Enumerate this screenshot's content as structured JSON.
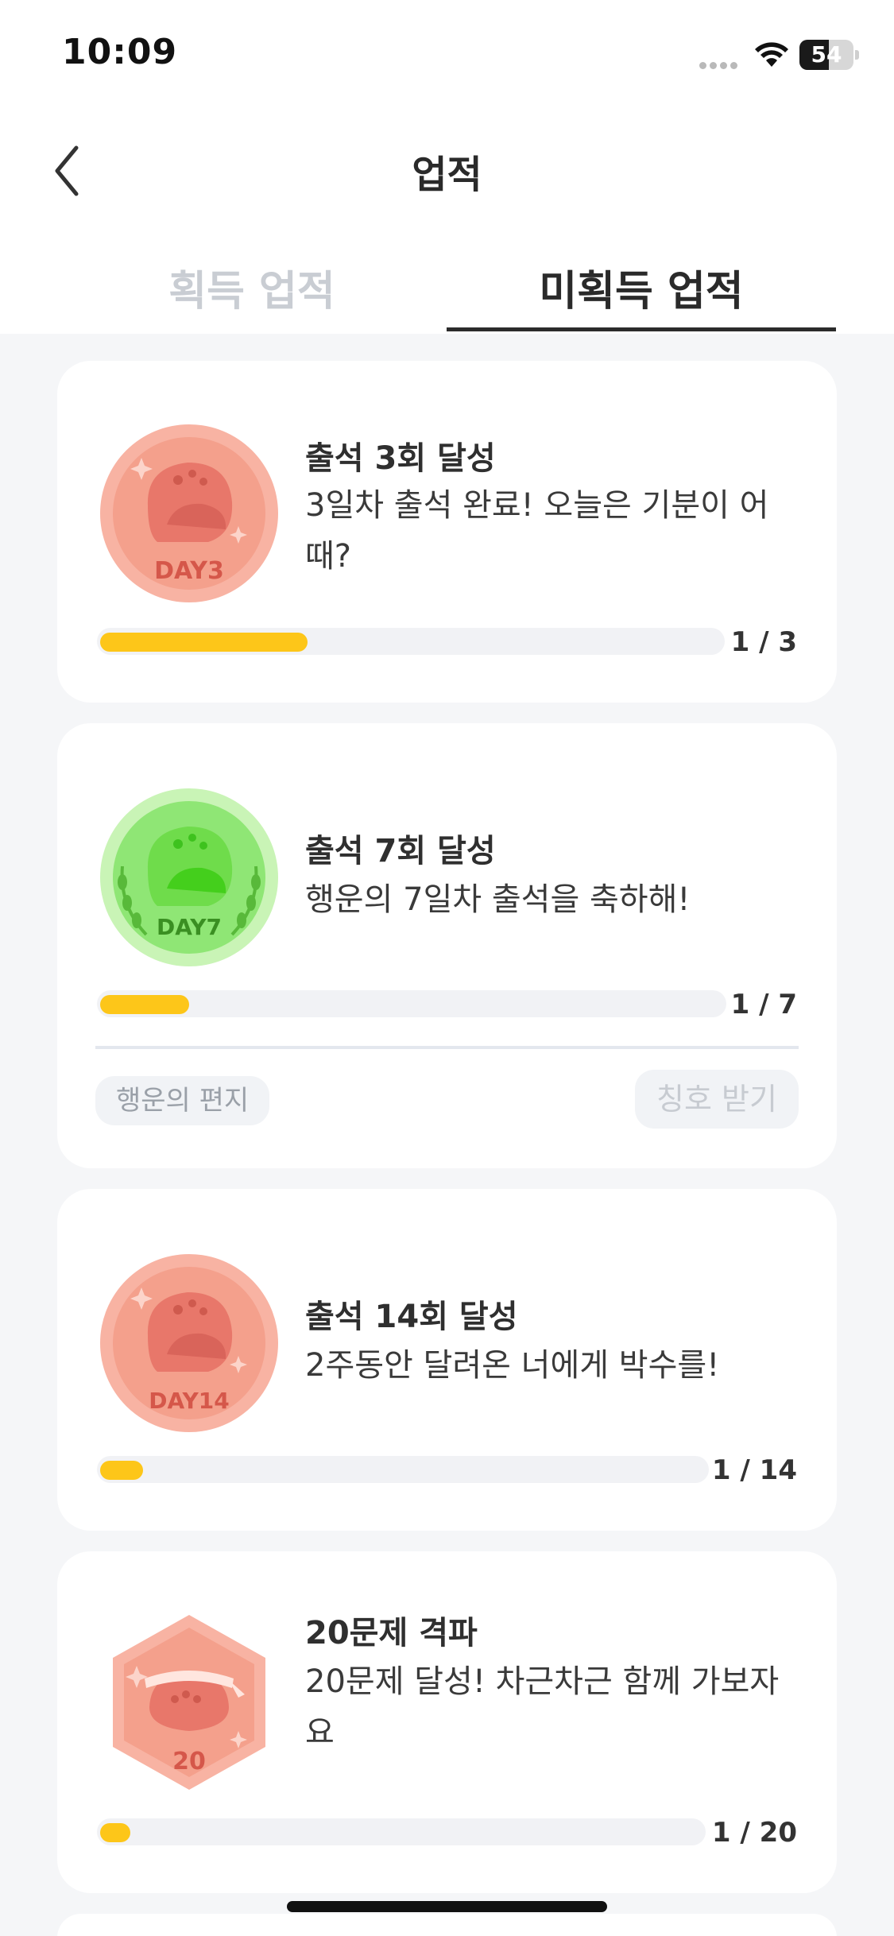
{
  "status_bar": {
    "time": "10:09",
    "battery": "54",
    "battery_level": 0.54,
    "icons": [
      "signal-dots-icon",
      "wifi-icon",
      "battery-icon"
    ]
  },
  "nav": {
    "title": "업적",
    "back_icon": "chevron-left-icon"
  },
  "tabs": [
    {
      "label": "획득 업적",
      "active": false
    },
    {
      "label": "미획득 업적",
      "active": true
    }
  ],
  "achievements": [
    {
      "title": "출석 3회 달성",
      "description": "3일차 출석 완료! 오늘은 기분이 어때?",
      "badge_label": "DAY3",
      "badge_color": "#f4a08c",
      "progress_text": "1 / 3",
      "progress": 0.3333
    },
    {
      "title": "출석 7회 달성",
      "description": "행운의 7일차 출석을 축하해!",
      "badge_label": "DAY7",
      "badge_color": "#6fdc4b",
      "progress_text": "1 / 7",
      "progress": 0.1429,
      "reward_chip": "행운의 편지",
      "claim_label": "칭호 받기"
    },
    {
      "title": "출석 14회 달성",
      "description": "2주동안 달려온 너에게 박수를!",
      "badge_label": "DAY14",
      "badge_color": "#f4a08c",
      "progress_text": "1 / 14",
      "progress": 0.0714
    },
    {
      "title": "20문제 격파",
      "description": "20문제 달성! 차근차근 함께 가보자요",
      "badge_label": "20",
      "badge_color": "#f4a08c",
      "progress_text": "1 / 20",
      "progress": 0.05
    }
  ],
  "colors": {
    "accent": "#fdc619",
    "track": "#f1f2f5",
    "background": "#f5f6f8",
    "tab_inactive": "#c9cdd3"
  }
}
